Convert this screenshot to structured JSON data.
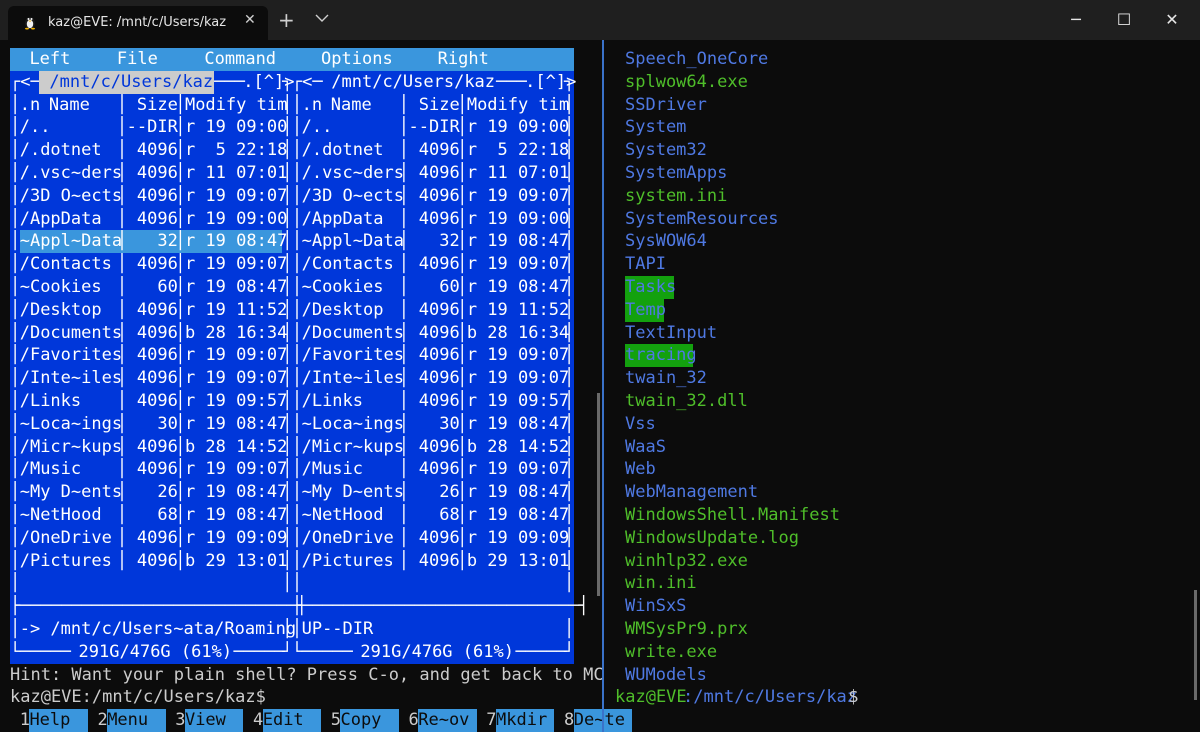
{
  "tab": {
    "title": "kaz@EVE: /mnt/c/Users/kaz",
    "icon": "linux-tux-icon",
    "close": "✕"
  },
  "titlebar": {
    "new_tab": "+",
    "minimize": "─",
    "maximize": "☐",
    "close": "✕"
  },
  "mc": {
    "menu": [
      "Left",
      "File",
      "Command",
      "Options",
      "Right"
    ],
    "left_path": " /mnt/c/Users/kaz ",
    "right_path": " /mnt/c/Users/kaz ",
    "columns": [
      ".n",
      "Name",
      "Size",
      "Modify tim"
    ],
    "files": [
      {
        "name": "/..",
        "size": "--DIR",
        "mod": "r 19 09:00"
      },
      {
        "name": "/.dotnet",
        "size": "4096",
        "mod": "r  5 22:18"
      },
      {
        "name": "/.vsc~ders",
        "size": "4096",
        "mod": "r 11 07:01"
      },
      {
        "name": "/3D O~ects",
        "size": "4096",
        "mod": "r 19 09:07"
      },
      {
        "name": "/AppData",
        "size": "4096",
        "mod": "r 19 09:00"
      },
      {
        "name": "~Appl~Data",
        "size": "32",
        "mod": "r 19 08:47"
      },
      {
        "name": "/Contacts",
        "size": "4096",
        "mod": "r 19 09:07"
      },
      {
        "name": "~Cookies",
        "size": "60",
        "mod": "r 19 08:47"
      },
      {
        "name": "/Desktop",
        "size": "4096",
        "mod": "r 19 11:52"
      },
      {
        "name": "/Documents",
        "size": "4096",
        "mod": "b 28 16:34"
      },
      {
        "name": "/Favorites",
        "size": "4096",
        "mod": "r 19 09:07"
      },
      {
        "name": "/Inte~iles",
        "size": "4096",
        "mod": "r 19 09:07"
      },
      {
        "name": "/Links",
        "size": "4096",
        "mod": "r 19 09:57"
      },
      {
        "name": "~Loca~ings",
        "size": "30",
        "mod": "r 19 08:47"
      },
      {
        "name": "/Micr~kups",
        "size": "4096",
        "mod": "b 28 14:52"
      },
      {
        "name": "/Music",
        "size": "4096",
        "mod": "r 19 09:07"
      },
      {
        "name": "~My D~ents",
        "size": "26",
        "mod": "r 19 08:47"
      },
      {
        "name": "~NetHood",
        "size": "68",
        "mod": "r 19 08:47"
      },
      {
        "name": "/OneDrive",
        "size": "4096",
        "mod": "r 19 09:09"
      },
      {
        "name": "/Pictures",
        "size": "4096",
        "mod": "b 29 13:01"
      }
    ],
    "selected_index": 5,
    "left_status": "-> /mnt/c/Users~ata/Roaming",
    "right_status": "UP--DIR",
    "disk": " 291G/476G (61%) ",
    "hint": "Hint: Want your plain shell? Press C-o, and get back to MC",
    "prompt_user": "kaz@EVE",
    "prompt_path": ":/mnt/c/Users/kaz",
    "prompt_sym": "$",
    "fkeys": [
      {
        "num": "1",
        "label": "Help"
      },
      {
        "num": "2",
        "label": "Menu"
      },
      {
        "num": "3",
        "label": "View"
      },
      {
        "num": "4",
        "label": "Edit"
      },
      {
        "num": "5",
        "label": "Copy"
      },
      {
        "num": "6",
        "label": "Re~ov"
      },
      {
        "num": "7",
        "label": "Mkdir"
      },
      {
        "num": "8",
        "label": "De~te"
      }
    ]
  },
  "right_pane": {
    "entries": [
      {
        "text": "Speech_OneCore",
        "kind": "dir"
      },
      {
        "text": "splwow64.exe",
        "kind": "exe"
      },
      {
        "text": "SSDriver",
        "kind": "dir"
      },
      {
        "text": "System",
        "kind": "dir"
      },
      {
        "text": "System32",
        "kind": "dir"
      },
      {
        "text": "SystemApps",
        "kind": "dir"
      },
      {
        "text": "system.ini",
        "kind": "exe"
      },
      {
        "text": "SystemResources",
        "kind": "dir"
      },
      {
        "text": "SysWOW64",
        "kind": "dir"
      },
      {
        "text": "TAPI",
        "kind": "dir"
      },
      {
        "text": "Tasks",
        "kind": "hl"
      },
      {
        "text": "Temp",
        "kind": "hl"
      },
      {
        "text": "TextInput",
        "kind": "dir"
      },
      {
        "text": "tracing",
        "kind": "hl"
      },
      {
        "text": "twain_32",
        "kind": "dir"
      },
      {
        "text": "twain_32.dll",
        "kind": "exe"
      },
      {
        "text": "Vss",
        "kind": "dir"
      },
      {
        "text": "WaaS",
        "kind": "dir"
      },
      {
        "text": "Web",
        "kind": "dir"
      },
      {
        "text": "WebManagement",
        "kind": "dir"
      },
      {
        "text": "WindowsShell.Manifest",
        "kind": "exe"
      },
      {
        "text": "WindowsUpdate.log",
        "kind": "exe"
      },
      {
        "text": "winhlp32.exe",
        "kind": "exe"
      },
      {
        "text": "win.ini",
        "kind": "exe"
      },
      {
        "text": "WinSxS",
        "kind": "dir"
      },
      {
        "text": "WMSysPr9.prx",
        "kind": "exe"
      },
      {
        "text": "write.exe",
        "kind": "exe"
      },
      {
        "text": "WUModels",
        "kind": "dir"
      }
    ],
    "prompt_user": "kaz@EVE",
    "prompt_path": ":/mnt/c/Users/kaz",
    "prompt_sym": "$"
  },
  "colors": {
    "mc_bg": "#0037da",
    "menu_bg": "#3a96dd",
    "dir": "#4f79e3",
    "file": "#4fbe2a",
    "highlight": "#13a10e"
  }
}
